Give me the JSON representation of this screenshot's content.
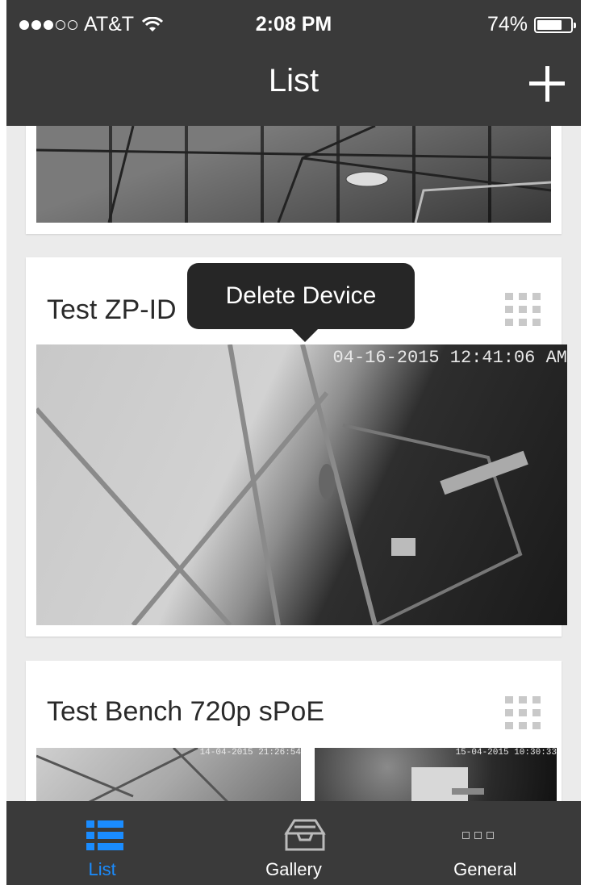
{
  "status_bar": {
    "carrier": "AT&T",
    "time": "2:08 PM",
    "battery_percent": "74%",
    "battery_level": 0.74,
    "signal_bars_filled": 3,
    "signal_bars_total": 5
  },
  "nav": {
    "title": "List",
    "add_icon": "plus-icon"
  },
  "devices": [
    {
      "title": "",
      "feed_timestamps": []
    },
    {
      "title": "Test ZP-ID",
      "feed_timestamps": [
        "04-16-2015 12:41:06 AM"
      ],
      "menu_icon": "grid-icon"
    },
    {
      "title": "Test Bench 720p sPoE",
      "feed_timestamps": [
        "14-04-2015 21:26:54",
        "15-04-2015 10:30:33"
      ],
      "menu_icon": "grid-icon"
    }
  ],
  "tooltip": {
    "label": "Delete Device"
  },
  "tabs": [
    {
      "label": "List",
      "icon": "list-icon",
      "active": true,
      "active_color": "#1a8cff"
    },
    {
      "label": "Gallery",
      "icon": "tray-icon",
      "active": false
    },
    {
      "label": "General",
      "icon": "more-icon",
      "active": false
    }
  ],
  "colors": {
    "bar_background": "#3a3a3a",
    "accent": "#1a8cff",
    "content_background": "#ebebeb"
  }
}
